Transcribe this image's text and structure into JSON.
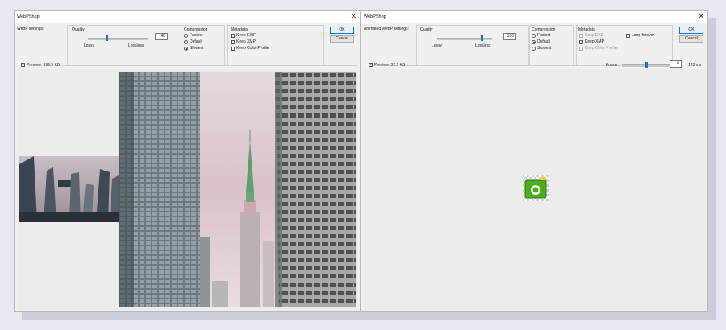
{
  "left": {
    "title": "WebPShop",
    "settings_label": "WebP settings:",
    "quality": {
      "label": "Quality",
      "value": "40",
      "min_label": "Lossy",
      "max_label": "Lossless"
    },
    "compression": {
      "label": "Compression",
      "options": [
        "Fastest",
        "Default",
        "Slowest"
      ],
      "selected": "Slowest"
    },
    "metadata": {
      "label": "Metadata",
      "options": [
        "Keep EXIF",
        "Keep XMP",
        "Keep Color Profile"
      ]
    },
    "ok_label": "OK",
    "cancel_label": "Cancel",
    "preview_label": "Preview: 399.9 KB"
  },
  "right": {
    "title": "WebPShop",
    "settings_label": "Animated WebP settings:",
    "quality": {
      "label": "Quality",
      "value": "100",
      "min_label": "Lossy",
      "max_label": "Lossless"
    },
    "compression": {
      "label": "Compression",
      "options": [
        "Fastest",
        "Default",
        "Slowest"
      ],
      "selected": "Default"
    },
    "metadata": {
      "label": "Metadata",
      "options": [
        "Keep EXIF",
        "Keep XMP",
        "Keep Color Profile",
        "Loop forever"
      ]
    },
    "ok_label": "OK",
    "cancel_label": "Cancel",
    "preview_label": "Preview: 32.3 KB",
    "frame_label": "Frame:",
    "frame_value": "6",
    "frame_duration": "123 ms"
  },
  "colors": {
    "accent": "#1f6fd1",
    "icon_green": "#4caf1a",
    "dialog_bg": "#f0f0f0"
  },
  "icons": {
    "close": "close-icon",
    "preview_placeholder": "webp-image-icon"
  }
}
